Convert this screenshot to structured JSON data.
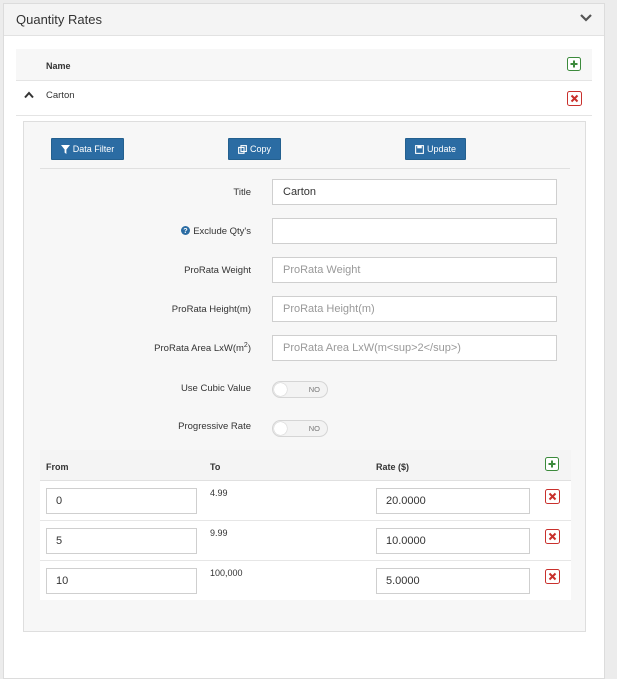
{
  "panel": {
    "title": "Quantity Rates"
  },
  "list": {
    "column_name": "Name",
    "items": [
      {
        "name": "Carton"
      }
    ]
  },
  "toolbar": {
    "data_filter": "Data Filter",
    "copy": "Copy",
    "update": "Update"
  },
  "form": {
    "title": {
      "label": "Title",
      "value": "Carton",
      "placeholder": ""
    },
    "exclude_qty": {
      "label": "Exclude Qty's",
      "value": "",
      "placeholder": ""
    },
    "prorata_weight": {
      "label": "ProRata Weight",
      "value": "",
      "placeholder": "ProRata Weight"
    },
    "prorata_height": {
      "label": "ProRata Height(m)",
      "value": "",
      "placeholder": "ProRata Height(m)"
    },
    "prorata_area": {
      "label_prefix": "ProRata Area LxW(m",
      "label_sup": "2",
      "label_suffix": ")",
      "value": "",
      "placeholder": "ProRata Area LxW(m<sup>2</sup>)"
    },
    "use_cubic": {
      "label": "Use Cubic Value",
      "state": "NO"
    },
    "progressive": {
      "label": "Progressive Rate",
      "state": "NO"
    }
  },
  "rates": {
    "columns": {
      "from": "From",
      "to": "To",
      "rate": "Rate ($)"
    },
    "rows": [
      {
        "from": "0",
        "to": "4.99",
        "rate": "20.0000"
      },
      {
        "from": "5",
        "to": "9.99",
        "rate": "10.0000"
      },
      {
        "from": "10",
        "to": "100,000",
        "rate": "5.0000"
      }
    ]
  },
  "colors": {
    "primary_button": "#2b6ca3",
    "add_icon": "#3c8a3c",
    "delete_icon": "#c9302c"
  }
}
